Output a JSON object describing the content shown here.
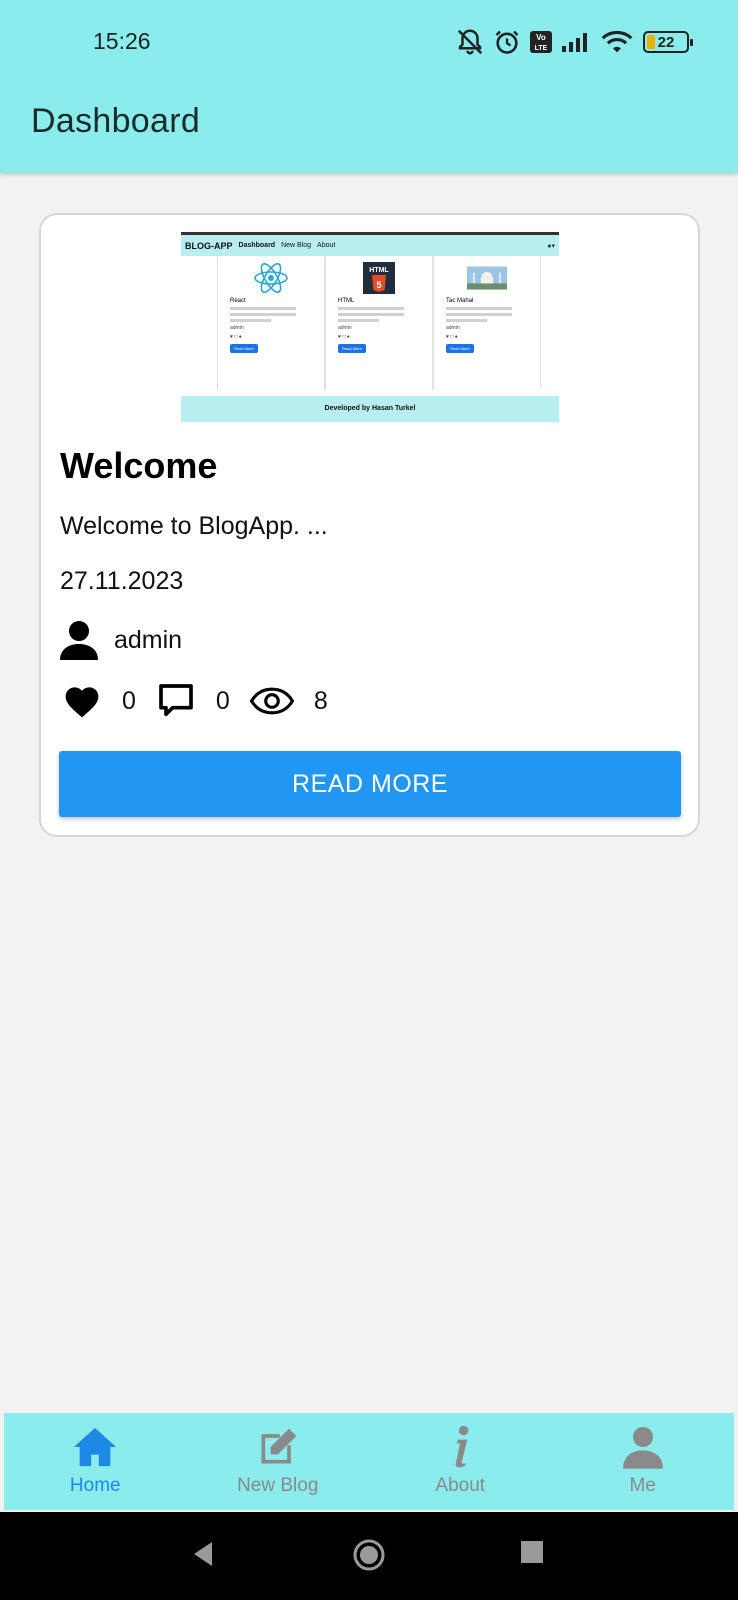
{
  "status_bar": {
    "time": "15:26",
    "battery_level": "22",
    "network_badge": "Vo LTE"
  },
  "header": {
    "title": "Dashboard"
  },
  "card": {
    "thumbnail": {
      "brand": "BLOG-APP",
      "nav_items": [
        "Dashboard",
        "New Blog",
        "About"
      ],
      "posts": [
        {
          "title": "React",
          "author": "admin",
          "button": "Read More",
          "icon": "react-logo"
        },
        {
          "title": "HTML",
          "author": "admin",
          "button": "Read More",
          "icon": "html5-logo"
        },
        {
          "title": "Tac Mahal",
          "author": "admin",
          "button": "Read More",
          "icon": "taj-mahal-photo"
        }
      ],
      "footer": "Developed by Hasan Turkel"
    },
    "title": "Welcome",
    "description": "Welcome to BlogApp. ...",
    "date": "27.11.2023",
    "author": "admin",
    "likes": "0",
    "comments": "0",
    "views": "8",
    "read_more_label": "READ MORE"
  },
  "bottom_nav": [
    {
      "label": "Home",
      "icon": "home-icon",
      "active": true
    },
    {
      "label": "New Blog",
      "icon": "edit-icon",
      "active": false
    },
    {
      "label": "About",
      "icon": "info-icon",
      "active": false
    },
    {
      "label": "Me",
      "icon": "person-icon",
      "active": false
    }
  ],
  "colors": {
    "header_bg": "#8aecec",
    "accent": "#2196f3",
    "active_nav": "#1e88e5",
    "inactive_nav": "#8a8a8a"
  }
}
